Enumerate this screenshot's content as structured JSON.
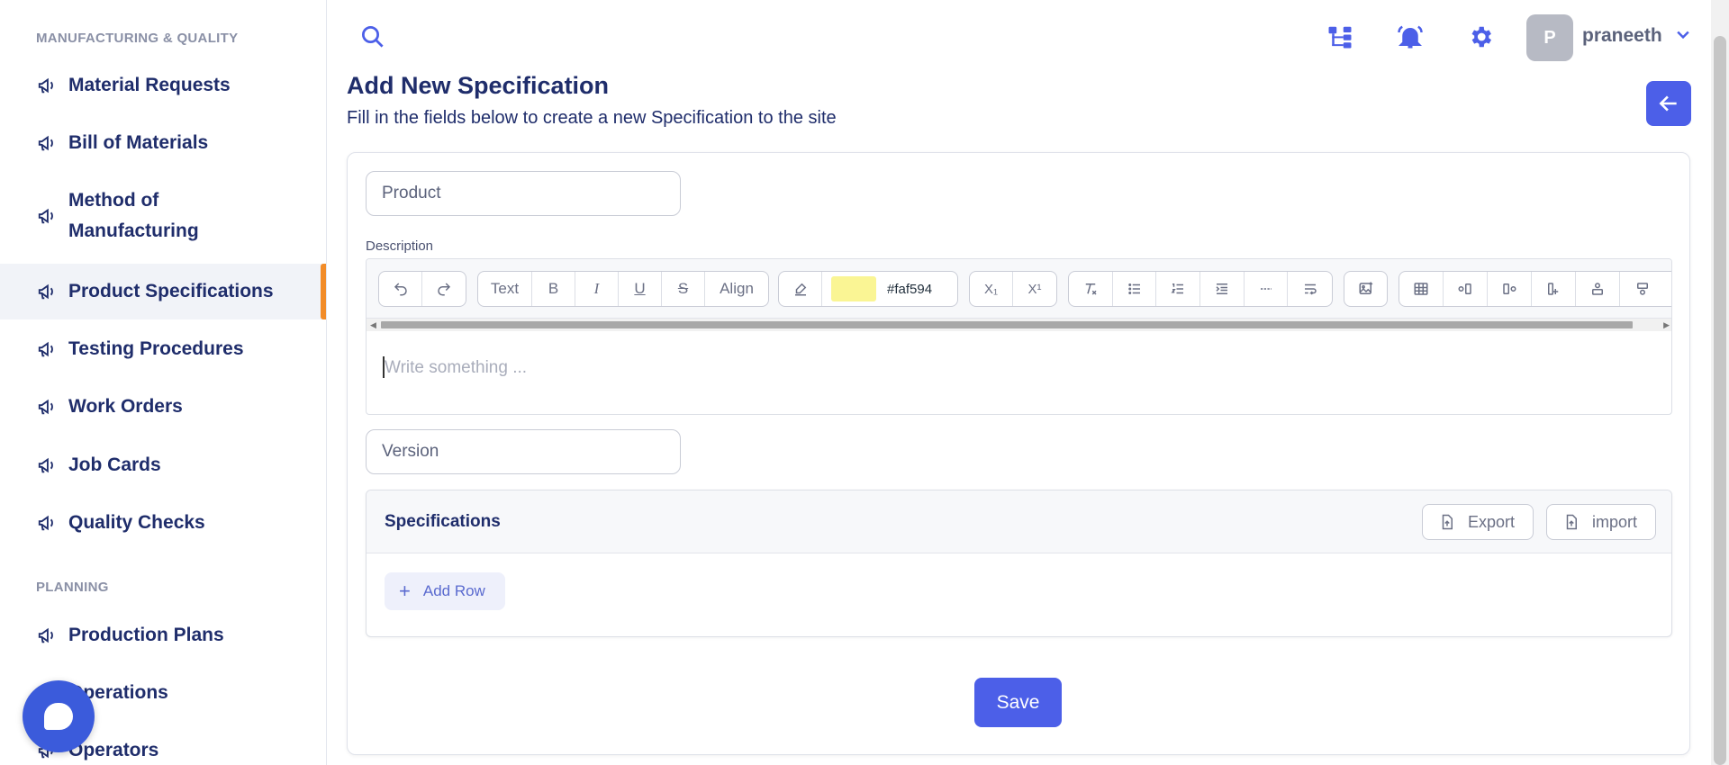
{
  "sidebar": {
    "section_manufacturing": "MANUFACTURING & QUALITY",
    "section_planning": "PLANNING",
    "items": [
      {
        "label": "Material Requests"
      },
      {
        "label": "Bill of Materials"
      },
      {
        "label": "Method of"
      },
      {
        "label": "Manufacturing"
      },
      {
        "label": "Product Specifications"
      },
      {
        "label": "Testing Procedures"
      },
      {
        "label": "Work Orders"
      },
      {
        "label": "Job Cards"
      },
      {
        "label": "Quality Checks"
      },
      {
        "label": "Production Plans"
      },
      {
        "label": "Operations"
      },
      {
        "label": "Operators"
      }
    ],
    "active_item": "Product Specifications",
    "accent_color": "#f28c28"
  },
  "topbar": {
    "avatar_initial": "P",
    "username": "praneeth",
    "icons": [
      "search-icon",
      "sitemap-icon",
      "bell-icon",
      "gear-icon",
      "chevron-down-icon"
    ]
  },
  "page": {
    "title": "Add New Specification",
    "subtitle": "Fill in the fields below to create a new Specification to the site"
  },
  "form": {
    "product_placeholder": "Product",
    "description_label": "Description",
    "editor_placeholder": "Write something ...",
    "version_placeholder": "Version"
  },
  "editor_toolbar": {
    "text_label": "Text",
    "bold_label": "B",
    "italic_label": "I",
    "underline_label": "U",
    "strike_label": "S",
    "align_label": "Align",
    "highlight_color": "#faf594",
    "highlight_text": "#faf594",
    "subscript_label": "X₁",
    "superscript_label": "X¹"
  },
  "specifications": {
    "title": "Specifications",
    "export_label": "Export",
    "import_label": "import",
    "add_row_label": "Add Row"
  },
  "actions": {
    "save_label": "Save"
  },
  "colors": {
    "primary": "#4c5fe8",
    "navy_text": "#1f2d6b"
  }
}
